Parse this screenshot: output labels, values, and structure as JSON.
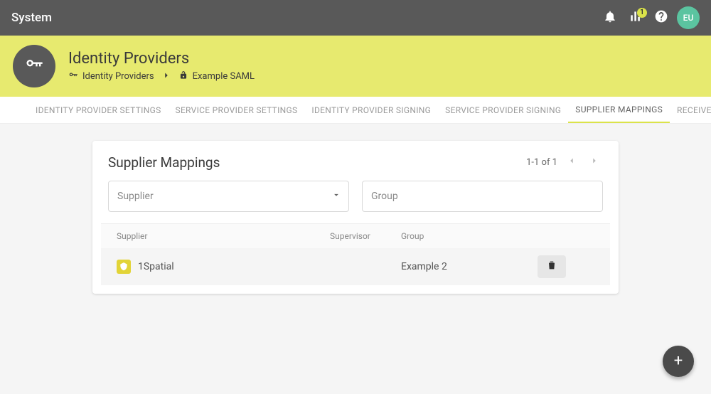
{
  "appbar": {
    "title": "System",
    "chart_badge": "1",
    "avatar_initials": "EU"
  },
  "hero": {
    "page_title": "Identity Providers",
    "breadcrumb": {
      "root": "Identity Providers",
      "leaf": "Example SAML"
    }
  },
  "tabs": [
    {
      "label": "IDENTITY PROVIDER SETTINGS",
      "active": false
    },
    {
      "label": "SERVICE PROVIDER SETTINGS",
      "active": false
    },
    {
      "label": "IDENTITY PROVIDER SIGNING",
      "active": false
    },
    {
      "label": "SERVICE PROVIDER SIGNING",
      "active": false
    },
    {
      "label": "SUPPLIER MAPPINGS",
      "active": true
    },
    {
      "label": "RECEIVER MAPPINGS",
      "active": false
    }
  ],
  "card": {
    "title": "Supplier Mappings",
    "pager_text": "1-1 of 1",
    "filters": {
      "supplier_label": "Supplier",
      "group_label": "Group"
    },
    "columns": {
      "supplier": "Supplier",
      "supervisor": "Supervisor",
      "group": "Group"
    },
    "rows": [
      {
        "supplier": "1Spatial",
        "supervisor": "",
        "group": "Example 2"
      }
    ]
  },
  "fab": {
    "label": "+"
  },
  "icons": {
    "bell": "bell-icon",
    "chart": "bar-chart-icon",
    "help": "help-icon",
    "key": "key-icon",
    "lock": "lock-open-icon",
    "chevron_right": "chevron-right-icon",
    "chevron_left": "chevron-left-icon",
    "caret_down": "caret-down-icon",
    "trash": "trash-icon",
    "plus": "plus-icon"
  }
}
